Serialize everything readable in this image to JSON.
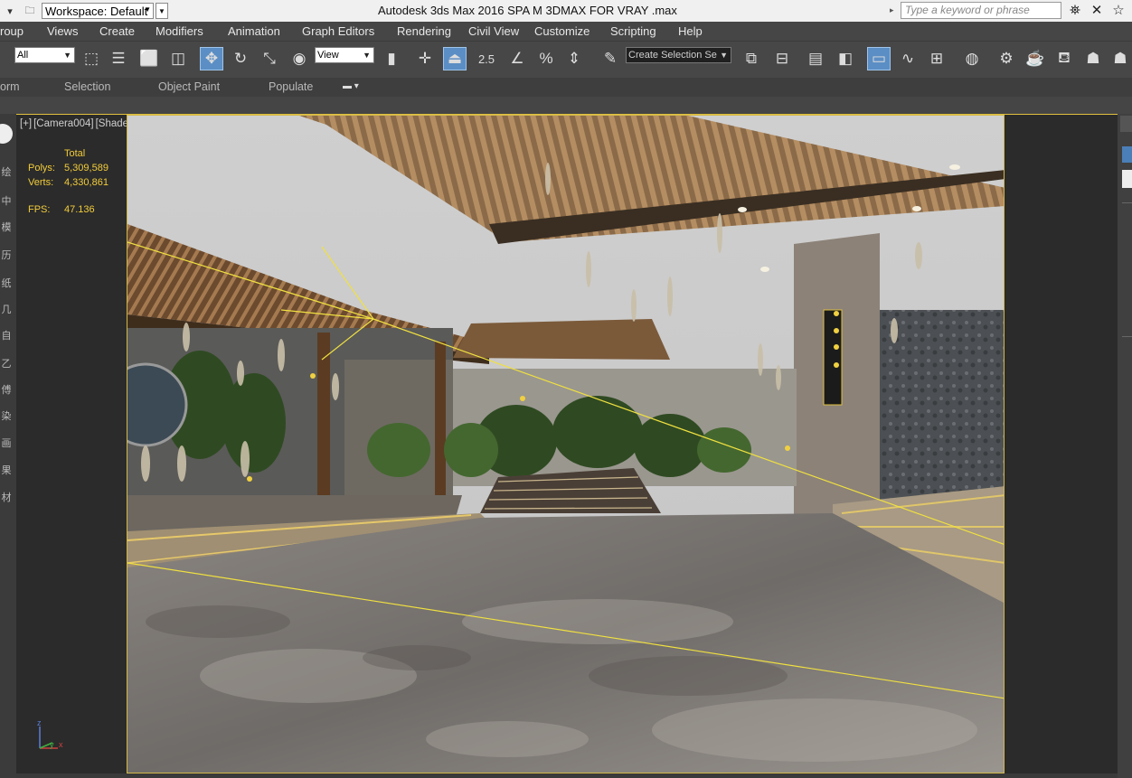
{
  "titlebar": {
    "workspace_value": "Workspace: Default",
    "app_title": "Autodesk 3ds Max 2016     SPA M 3DMAX FOR VRAY .max",
    "search_placeholder": "Type a keyword or phrase"
  },
  "menu": {
    "items": [
      "roup",
      "Views",
      "Create",
      "Modifiers",
      "Animation",
      "Graph Editors",
      "Rendering",
      "Civil View",
      "Customize",
      "Scripting",
      "Help"
    ]
  },
  "toolbar": {
    "filter_value": "All",
    "refcoord_value": "View",
    "snap_label": "2.5",
    "selection_set_placeholder": "Create Selection Se"
  },
  "ribbon": {
    "items": [
      "orm",
      "Selection",
      "Object Paint",
      "Populate"
    ]
  },
  "viewport": {
    "label_parts": [
      "[+]",
      "[Camera004]",
      "[Shaded]"
    ],
    "stats": {
      "total_label": "Total",
      "polys_label": "Polys:",
      "polys_value": "5,309,589",
      "verts_label": "Verts:",
      "verts_value": "4,330,861",
      "fps_label": "FPS:",
      "fps_value": "47.136"
    },
    "axis_labels": {
      "z": "z",
      "x": "x",
      "y": "y"
    }
  },
  "left_strip_glyphs": [
    "绘",
    "中",
    "模",
    "历",
    "纸",
    "几",
    "自",
    "乙",
    "傅",
    "染",
    "画",
    "果",
    "材"
  ],
  "colors": {
    "ui_dark": "#444444",
    "menu_bg": "#464646",
    "stats_yellow": "#f2cc3a",
    "active_blue": "#5b8ec4"
  }
}
